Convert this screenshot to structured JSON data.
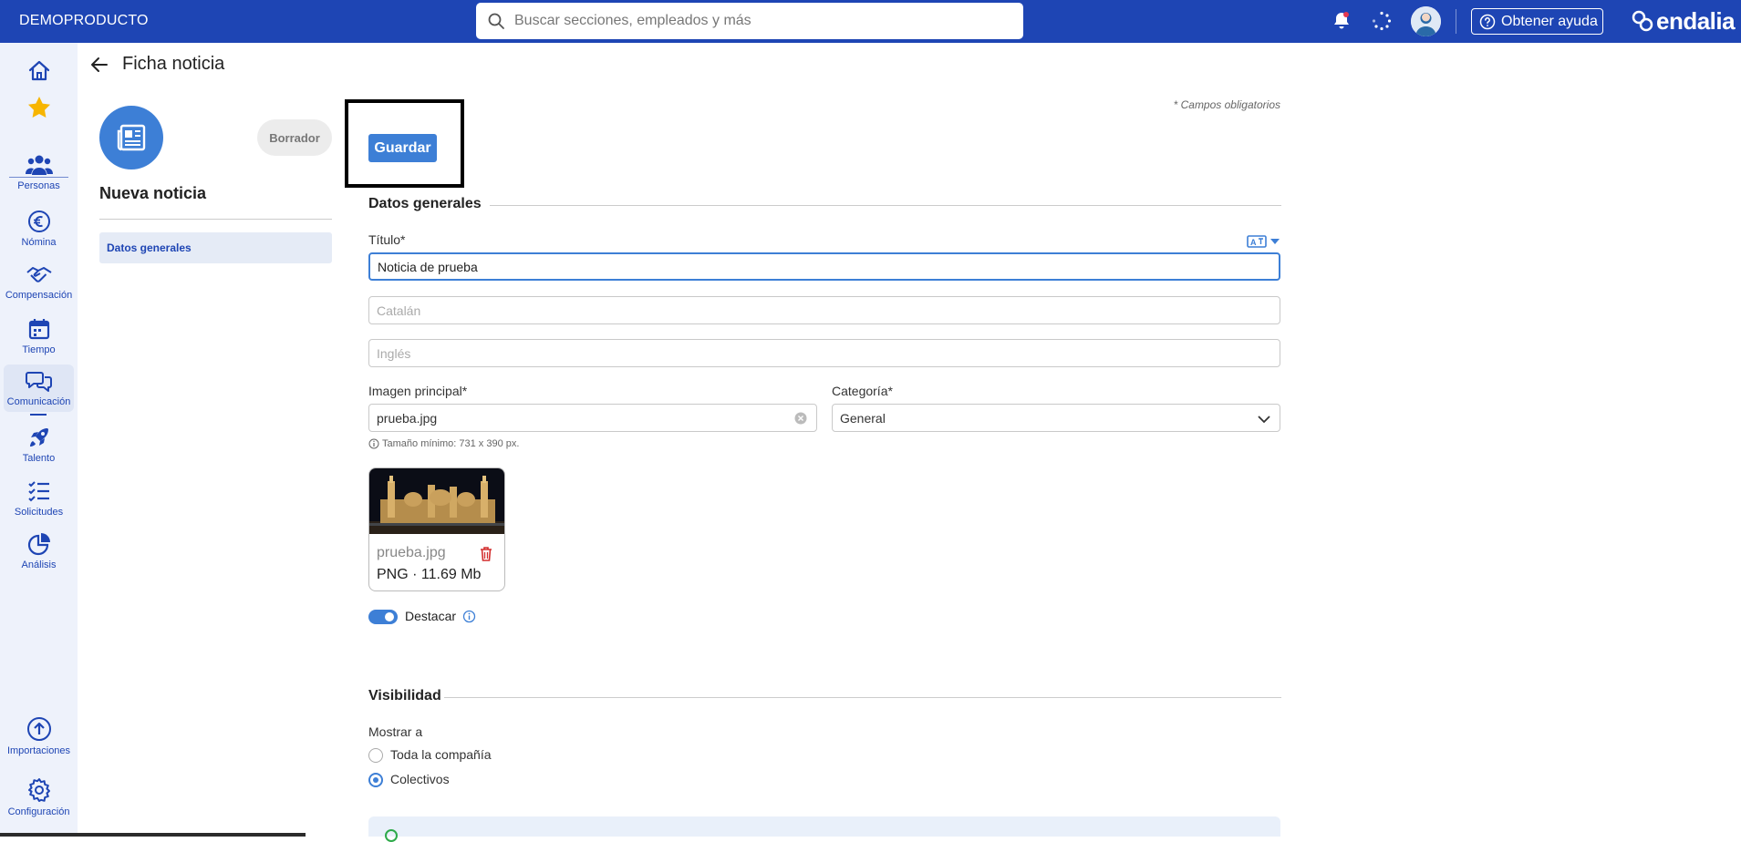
{
  "topbar": {
    "brand": "DEMOPRODUCTO",
    "search_placeholder": "Buscar secciones, empleados y más",
    "help_label": "Obtener ayuda",
    "logo_text": "endalia"
  },
  "sidebar": {
    "items": [
      {
        "label": "",
        "icon": "home-icon"
      },
      {
        "label": "",
        "icon": "star-icon"
      },
      {
        "label": "Personas",
        "icon": "people-icon"
      },
      {
        "label": "Nómina",
        "icon": "euro-icon"
      },
      {
        "label": "Compensación",
        "icon": "handshake-icon"
      },
      {
        "label": "Tiempo",
        "icon": "calendar-icon"
      },
      {
        "label": "Comunicación",
        "icon": "chat-icon"
      },
      {
        "label": "Talento",
        "icon": "rocket-icon"
      },
      {
        "label": "Solicitudes",
        "icon": "checklist-icon"
      },
      {
        "label": "Análisis",
        "icon": "pie-chart-icon"
      },
      {
        "label": "Importaciones",
        "icon": "upload-icon"
      },
      {
        "label": "Configuración",
        "icon": "gear-icon"
      }
    ]
  },
  "header": {
    "title": "Ficha noticia"
  },
  "left_panel": {
    "status": "Borrador",
    "name": "Nueva noticia",
    "nav_items": [
      "Datos generales"
    ]
  },
  "form": {
    "save_label": "Guardar",
    "required_note": "* Campos obligatorios",
    "section_general": "Datos generales",
    "title_label": "Título*",
    "title_value": "Noticia de prueba",
    "catalan_placeholder": "Catalán",
    "english_placeholder": "Inglés",
    "image_label": "Imagen principal*",
    "image_value": "prueba.jpg",
    "category_label": "Categoría*",
    "category_value": "General",
    "image_hint": "Tamaño mínimo: 731 x 390 px.",
    "image_card": {
      "name": "prueba.jpg",
      "meta": "PNG · 11.69 Mb"
    },
    "highlight_label": "Destacar",
    "highlight_on": true,
    "section_visibility": "Visibilidad",
    "show_to_label": "Mostrar a",
    "visibility_options": [
      "Toda la compañía",
      "Colectivos"
    ],
    "visibility_selected": "Colectivos"
  },
  "colors": {
    "primary": "#1e45b4",
    "accent": "#3d7fd6",
    "danger": "#d32f2f"
  }
}
